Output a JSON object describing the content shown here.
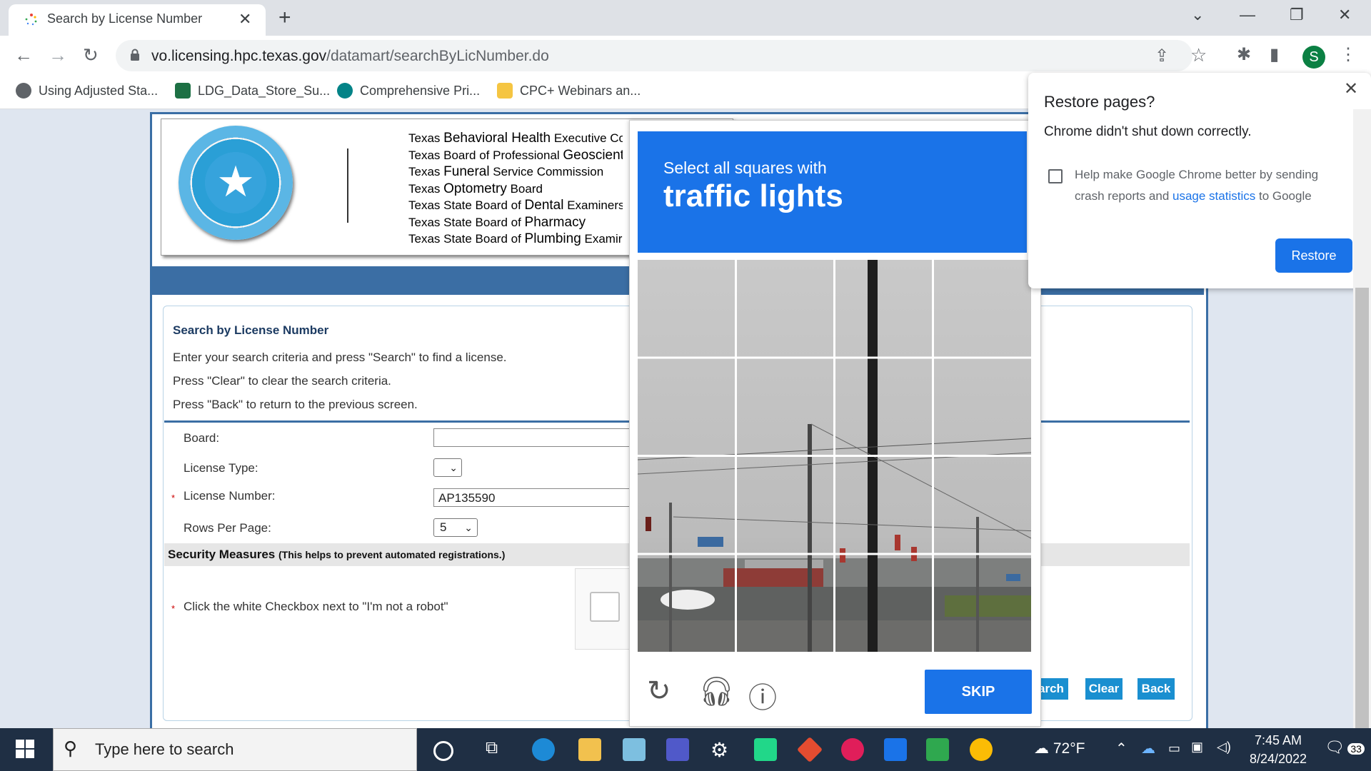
{
  "browser": {
    "tab_title": "Search by License Number",
    "url_host": "vo.licensing.hpc.texas.gov",
    "url_path": "/datamart/searchByLicNumber.do",
    "avatar_letter": "S",
    "bookmarks": [
      {
        "label": "Using Adjusted Sta...",
        "icon": "globe-icon"
      },
      {
        "label": "LDG_Data_Store_Su...",
        "icon": "excel-icon"
      },
      {
        "label": "Comprehensive Pri...",
        "icon": "sharepoint-icon"
      },
      {
        "label": "CPC+ Webinars an...",
        "icon": "folder-icon"
      }
    ]
  },
  "header": {
    "boards": [
      {
        "pre": "Texas ",
        "big": "Behavioral Health",
        "post": " Executive Co"
      },
      {
        "pre": "Texas Board of Professional ",
        "big": "Geoscient",
        "post": ""
      },
      {
        "pre": "Texas ",
        "big": "Funeral",
        "post": " Service Commission"
      },
      {
        "pre": "Texas ",
        "big": "Optometry",
        "post": " Board"
      },
      {
        "pre": "Texas State Board of ",
        "big": "Dental",
        "post": " Examiners"
      },
      {
        "pre": "Texas State Board of ",
        "big": "Pharmacy",
        "post": ""
      },
      {
        "pre": "Texas State Board of ",
        "big": "Plumbing",
        "post": " Examir"
      }
    ]
  },
  "form": {
    "title": "Search by License Number",
    "instructions": [
      "Enter your search criteria and press \"Search\" to find a license.",
      "Press \"Clear\" to clear the search criteria.",
      "Press \"Back\" to return to the previous screen."
    ],
    "board_label": "Board:",
    "board_value": "",
    "license_type_label": "License Type:",
    "license_type_value": "",
    "license_number_label": "License Number:",
    "license_number_value": "AP135590",
    "rows_label": "Rows Per Page:",
    "rows_value": "5",
    "required_mark": "*",
    "security_title": "Security Measures",
    "security_note": "(This helps to prevent automated registrations.)",
    "robot_instruction": "Click the white Checkbox next to \"I'm not a robot\"",
    "search_btn": "arch",
    "clear_btn": "Clear",
    "back_btn": "Back"
  },
  "captcha": {
    "line1": "Select all squares with",
    "line2": "traffic lights",
    "skip": "SKIP",
    "icons": [
      "reload-icon",
      "audio-icon",
      "info-icon"
    ]
  },
  "restore_popup": {
    "title": "Restore pages?",
    "subtitle": "Chrome didn't shut down correctly.",
    "checkbox_text": "Help make Google Chrome better by sending crash reports and ",
    "link_text": "usage statistics",
    "checkbox_tail": " to Google",
    "button": "Restore"
  },
  "taskbar": {
    "search_placeholder": "Type here to search",
    "weather": "72°F",
    "time": "7:45 AM",
    "date": "8/24/2022",
    "notifications": "33"
  }
}
